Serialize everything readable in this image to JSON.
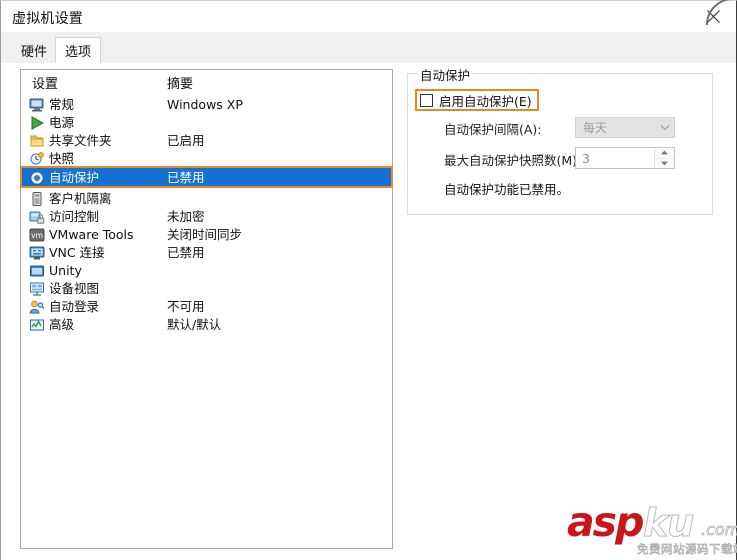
{
  "window": {
    "title": "虚拟机设置",
    "close_icon": "close-icon"
  },
  "tabs": [
    {
      "label": "硬件",
      "active": false
    },
    {
      "label": "选项",
      "active": true
    }
  ],
  "settings_list": {
    "headers": {
      "settings": "设置",
      "summary": "摘要"
    },
    "rows": [
      {
        "icon": "monitor-icon",
        "label": "常规",
        "summary": "Windows XP",
        "selected": false
      },
      {
        "icon": "power-play-icon",
        "label": "电源",
        "summary": "",
        "selected": false
      },
      {
        "icon": "folder-icon",
        "label": "共享文件夹",
        "summary": "已启用",
        "selected": false
      },
      {
        "icon": "snapshot-clock-icon",
        "label": "快照",
        "summary": "",
        "selected": false
      },
      {
        "icon": "autoprotect-icon",
        "label": "自动保护",
        "summary": "已禁用",
        "selected": true
      },
      {
        "icon": "guest-isolation-icon",
        "label": "客户机隔离",
        "summary": "",
        "selected": false
      },
      {
        "icon": "access-lock-icon",
        "label": "访问控制",
        "summary": "未加密",
        "selected": false
      },
      {
        "icon": "vmware-tools-icon",
        "label": "VMware Tools",
        "summary": "关闭时间同步",
        "selected": false
      },
      {
        "icon": "vnc-icon",
        "label": "VNC 连接",
        "summary": "已禁用",
        "selected": false
      },
      {
        "icon": "unity-icon",
        "label": "Unity",
        "summary": "",
        "selected": false
      },
      {
        "icon": "device-view-icon",
        "label": "设备视图",
        "summary": "",
        "selected": false
      },
      {
        "icon": "auto-login-icon",
        "label": "自动登录",
        "summary": "不可用",
        "selected": false
      },
      {
        "icon": "advanced-icon",
        "label": "高级",
        "summary": "默认/默认",
        "selected": false
      }
    ]
  },
  "autoprotect_panel": {
    "group_title": "自动保护",
    "enable_checkbox_label": "启用自动保护(E)",
    "enable_checked": false,
    "interval_label": "自动保护间隔(A):",
    "interval_value": "每天",
    "max_snapshots_label": "最大自动保护快照数(M):",
    "max_snapshots_value": "3",
    "status_text": "自动保护功能已禁用。"
  },
  "watermark": {
    "asp": "asp",
    "ku": "ku",
    "com": ".com",
    "sub": "免费网站源码下载站"
  },
  "colors": {
    "selection_blue": "#1571d3",
    "highlight_orange": "#e8891f",
    "watermark_red": "#c9161d",
    "disabled_gray": "#9d9d9d"
  }
}
